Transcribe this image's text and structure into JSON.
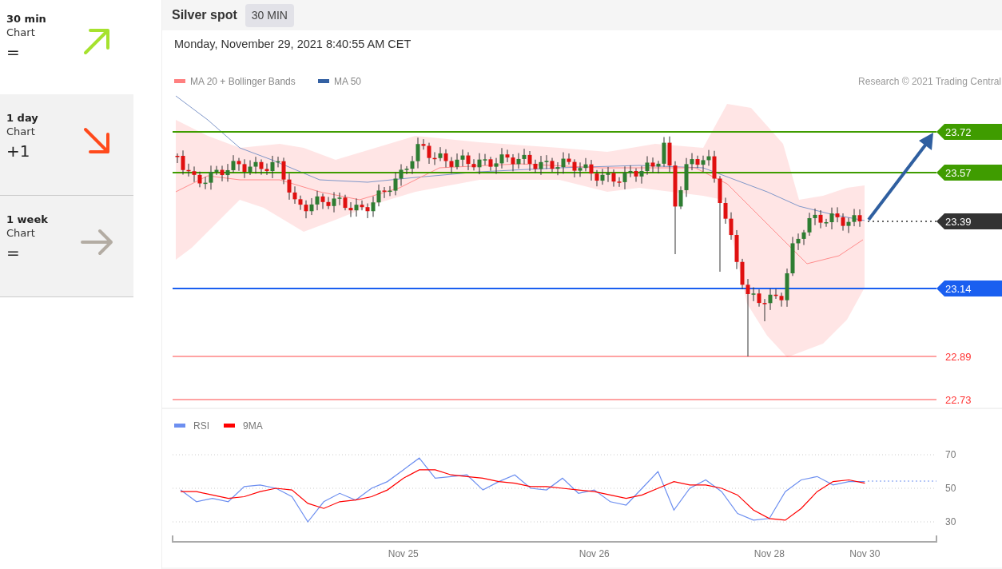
{
  "sidebar": {
    "items": [
      {
        "title": "30 min",
        "subtitle": "Chart",
        "symbol": "=",
        "kind": "up",
        "color": "#a6e22e",
        "selected": true
      },
      {
        "title": "1 day",
        "subtitle": "Chart",
        "symbol": "+1",
        "kind": "down",
        "color": "#ff4a1c",
        "selected": false
      },
      {
        "title": "1 week",
        "subtitle": "Chart",
        "symbol": "=",
        "kind": "right",
        "color": "#b3aca3",
        "selected": false
      }
    ]
  },
  "header": {
    "title": "Silver spot",
    "timeframe": "30 MIN"
  },
  "chart": {
    "timestamp": "Monday, November 29, 2021 8:40:55 AM CET",
    "legend": [
      {
        "label": "MA 20 + Bollinger Bands",
        "color": "#ff8080"
      },
      {
        "label": "MA 50",
        "color": "#3461a3"
      }
    ],
    "copyright": "Research © 2021 Trading Central",
    "levels": [
      {
        "label": "23.72",
        "kind": "tag",
        "color": "#3f9c00"
      },
      {
        "label": "23.57",
        "kind": "tag",
        "color": "#3f9c00"
      },
      {
        "label": "23.39",
        "kind": "current",
        "color": "#333333"
      },
      {
        "label": "23.14",
        "kind": "tag",
        "color": "#1a5ff0"
      },
      {
        "label": "22.89",
        "kind": "text",
        "color": "#ff3333"
      },
      {
        "label": "22.73",
        "kind": "text",
        "color": "#ff3333"
      }
    ]
  },
  "rsi": {
    "chart_data": {
      "type": "line",
      "categories": [
        null,
        null,
        null,
        null,
        null,
        null,
        null,
        null,
        null,
        null,
        null,
        null,
        null,
        null,
        "Nov 25",
        null,
        null,
        null,
        null,
        null,
        null,
        null,
        null,
        null,
        null,
        null,
        "Nov 26",
        null,
        null,
        null,
        null,
        null,
        null,
        null,
        null,
        null,
        null,
        "Nov 28",
        null,
        null,
        null,
        null,
        null,
        "Nov 30",
        null,
        null,
        null,
        null
      ],
      "series": [
        {
          "name": "RSI",
          "color": "#6d8ff0",
          "values": [
            49,
            42,
            44,
            42,
            51,
            52,
            50,
            45,
            30,
            42,
            47,
            43,
            50,
            54,
            61,
            68,
            56,
            57,
            58,
            49,
            54,
            58,
            50,
            49,
            56,
            47,
            49,
            42,
            40,
            50,
            60,
            37,
            50,
            55,
            48,
            35,
            31,
            32,
            48,
            55,
            57,
            52,
            54,
            54,
            null,
            null,
            null,
            null
          ]
        },
        {
          "name": "9MA",
          "color": "#ff0000",
          "values": [
            48,
            48,
            46,
            44,
            45,
            48,
            50,
            49,
            41,
            38,
            42,
            43,
            45,
            49,
            56,
            61,
            61,
            58,
            57,
            56,
            54,
            53,
            51,
            51,
            50,
            49,
            48,
            46,
            44,
            46,
            50,
            54,
            52,
            52,
            50,
            46,
            37,
            32,
            31,
            38,
            48,
            54,
            55,
            53,
            null,
            null,
            null,
            null
          ]
        }
      ],
      "grid": true,
      "legend": true,
      "ylim": [
        30,
        70
      ],
      "yticks": [
        30,
        50,
        70
      ]
    }
  }
}
